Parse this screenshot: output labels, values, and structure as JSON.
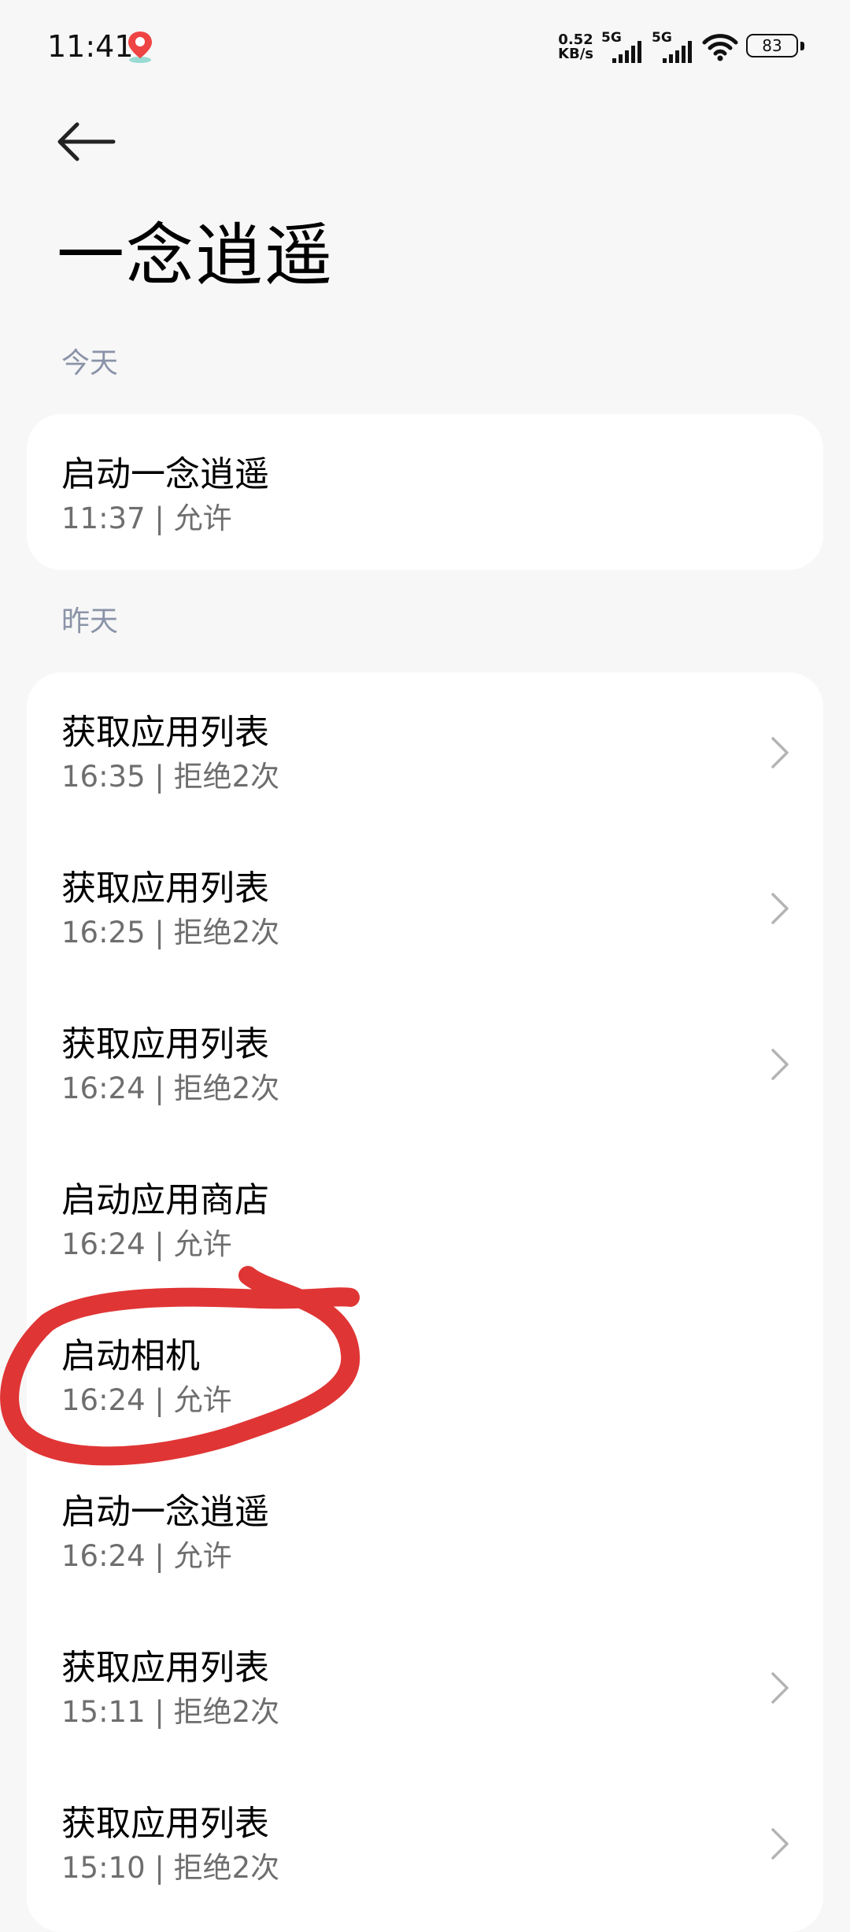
{
  "status_bar": {
    "time": "11:41",
    "net_speed_value": "0.52",
    "net_speed_unit": "KB/s",
    "sim1_tag": "5G",
    "sim2_tag": "5G",
    "battery": "83",
    "icons": [
      "map-pin-icon",
      "signal-icon",
      "wifi-icon",
      "battery-icon"
    ]
  },
  "header": {
    "back_icon": "back-arrow-icon",
    "title": "一念逍遥"
  },
  "sections": [
    {
      "label": "今天",
      "items": [
        {
          "title": "启动一念逍遥",
          "subtitle": "11:37 | 允许",
          "has_chevron": false
        }
      ]
    },
    {
      "label": "昨天",
      "items": [
        {
          "title": "获取应用列表",
          "subtitle": "16:35 | 拒绝2次",
          "has_chevron": true
        },
        {
          "title": "获取应用列表",
          "subtitle": "16:25 | 拒绝2次",
          "has_chevron": true
        },
        {
          "title": "获取应用列表",
          "subtitle": "16:24 | 拒绝2次",
          "has_chevron": true
        },
        {
          "title": "启动应用商店",
          "subtitle": "16:24 | 允许",
          "has_chevron": false
        },
        {
          "title": "启动相机",
          "subtitle": "16:24 | 允许",
          "has_chevron": false
        },
        {
          "title": "启动一念逍遥",
          "subtitle": "16:24 | 允许",
          "has_chevron": false
        },
        {
          "title": "获取应用列表",
          "subtitle": "15:11 | 拒绝2次",
          "has_chevron": true
        },
        {
          "title": "获取应用列表",
          "subtitle": "15:10 | 拒绝2次",
          "has_chevron": true
        }
      ]
    }
  ],
  "colors": {
    "background": "#f7f7f7",
    "card": "#ffffff",
    "section_label": "#8a93a8",
    "subtitle": "#6e6e6e",
    "annotation": "#e03535"
  }
}
